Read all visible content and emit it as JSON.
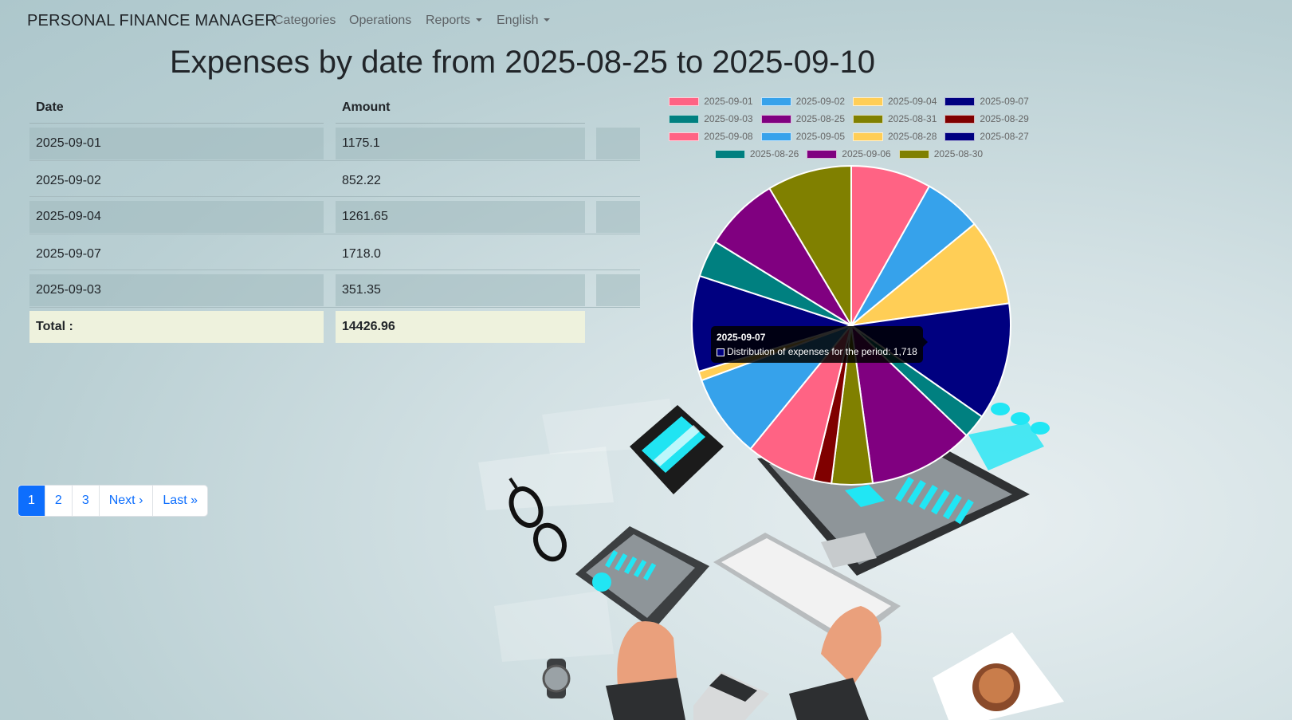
{
  "navbar": {
    "brand": "PERSONAL FINANCE MANAGER",
    "links": {
      "categories": "Categories",
      "operations": "Operations",
      "reports": "Reports",
      "language": "English"
    }
  },
  "page": {
    "title": "Expenses by date from 2025-08-25 to 2025-09-10"
  },
  "table": {
    "headers": {
      "date": "Date",
      "amount": "Amount"
    },
    "rows": [
      {
        "date": "2025-09-01",
        "amount": "1175.1"
      },
      {
        "date": "2025-09-02",
        "amount": "852.22"
      },
      {
        "date": "2025-09-04",
        "amount": "1261.65"
      },
      {
        "date": "2025-09-07",
        "amount": "1718.0"
      },
      {
        "date": "2025-09-03",
        "amount": "351.35"
      }
    ],
    "total_label": "Total :",
    "total_value": "14426.96"
  },
  "pagination": {
    "pages": [
      "1",
      "2",
      "3"
    ],
    "active": "1",
    "next": "Next ›",
    "last": "Last »"
  },
  "chart_data": {
    "type": "pie",
    "categories": [
      "2025-09-01",
      "2025-09-02",
      "2025-09-04",
      "2025-09-07",
      "2025-09-03",
      "2025-08-25",
      "2025-08-31",
      "2025-08-29",
      "2025-09-08",
      "2025-09-05",
      "2025-08-28",
      "2025-08-27",
      "2025-08-26",
      "2025-09-06",
      "2025-08-30"
    ],
    "values": [
      1175.1,
      852.22,
      1261.65,
      1718.0,
      351.35,
      1543.8,
      598.0,
      263.5,
      1020.4,
      1226.7,
      134.3,
      1398.6,
      542.1,
      1104.9,
      1236.34
    ],
    "colors": [
      "#ff6384",
      "#36a2eb",
      "#ffce56",
      "#000080",
      "#008080",
      "#800080",
      "#808000",
      "#800000",
      "#ff6384",
      "#36a2eb",
      "#ffce56",
      "#000080",
      "#008080",
      "#800080",
      "#808000"
    ],
    "series_name": "Distribution of expenses for the period",
    "legend_position": "top",
    "tooltip": {
      "title": "2025-09-07",
      "label": "Distribution of expenses for the period: 1,718"
    }
  }
}
